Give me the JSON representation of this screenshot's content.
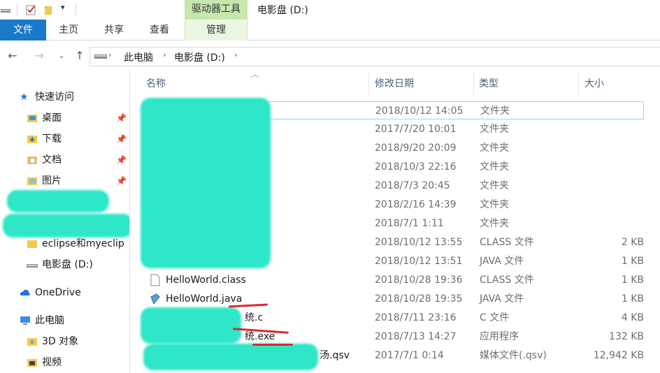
{
  "window": {
    "title": "电影盘 (D:)",
    "context_tab": "驱动器工具"
  },
  "ribbon": {
    "tabs": [
      "文件",
      "主页",
      "共享",
      "查看",
      "管理"
    ]
  },
  "address": {
    "segments": [
      "此电脑",
      "电影盘 (D:)"
    ]
  },
  "sidebar": {
    "quick_access": "快速访问",
    "items": [
      {
        "label": "桌面",
        "icon": "desktop-folder-icon",
        "pinned": true
      },
      {
        "label": "下载",
        "icon": "download-folder-icon",
        "pinned": true
      },
      {
        "label": "文档",
        "icon": "documents-folder-icon",
        "pinned": true
      },
      {
        "label": "图片",
        "icon": "pictures-folder-icon",
        "pinned": true
      }
    ],
    "folder_eclipse": "eclipse和myeclip",
    "drive": "电影盘 (D:)",
    "onedrive": "OneDrive",
    "this_pc": "此电脑",
    "objects_3d": "3D 对象",
    "videos": "视频"
  },
  "columns": {
    "name": "名称",
    "date": "修改日期",
    "type": "类型",
    "size": "大小"
  },
  "files": [
    {
      "name": "",
      "date": "2018/10/12 14:05",
      "type": "文件夹",
      "size": ""
    },
    {
      "name": "",
      "date": "2017/7/20 10:01",
      "type": "文件夹",
      "size": ""
    },
    {
      "name": "",
      "date": "2018/9/20 20:09",
      "type": "文件夹",
      "size": ""
    },
    {
      "name": "",
      "date": "2018/10/3 22:16",
      "type": "文件夹",
      "size": ""
    },
    {
      "name": "",
      "date": "2018/7/3 20:45",
      "type": "文件夹",
      "size": ""
    },
    {
      "name": "",
      "date": "2018/2/16 14:39",
      "type": "文件夹",
      "size": ""
    },
    {
      "name": "",
      "date": "2018/7/1 1:11",
      "type": "文件夹",
      "size": ""
    },
    {
      "name": "",
      "date": "2018/10/12 13:55",
      "type": "CLASS 文件",
      "size": "2 KB"
    },
    {
      "name": "",
      "date": "2018/10/12 13:51",
      "type": "JAVA 文件",
      "size": "1 KB"
    },
    {
      "name": "HelloWorld.class",
      "date": "2018/10/28 19:36",
      "type": "CLASS 文件",
      "size": "1 KB"
    },
    {
      "name": "HelloWorld.java",
      "date": "2018/10/28 19:35",
      "type": "JAVA 文件",
      "size": "1 KB"
    },
    {
      "name": "统.c",
      "date": "2018/7/11 23:16",
      "type": "C 文件",
      "size": "4 KB"
    },
    {
      "name": "统.exe",
      "date": "2018/7/13 14:27",
      "type": "应用程序",
      "size": "132 KB"
    },
    {
      "name": "汤.qsv",
      "date": "2017/7/1 0:14",
      "type": "媒体文件(.qsv)",
      "size": "12,942 KB"
    }
  ],
  "colors": {
    "file_tab": "#1979ca",
    "context_tab": "#c7e7ad",
    "scribble": "#2ee6c8",
    "underline": "#e0282e"
  }
}
